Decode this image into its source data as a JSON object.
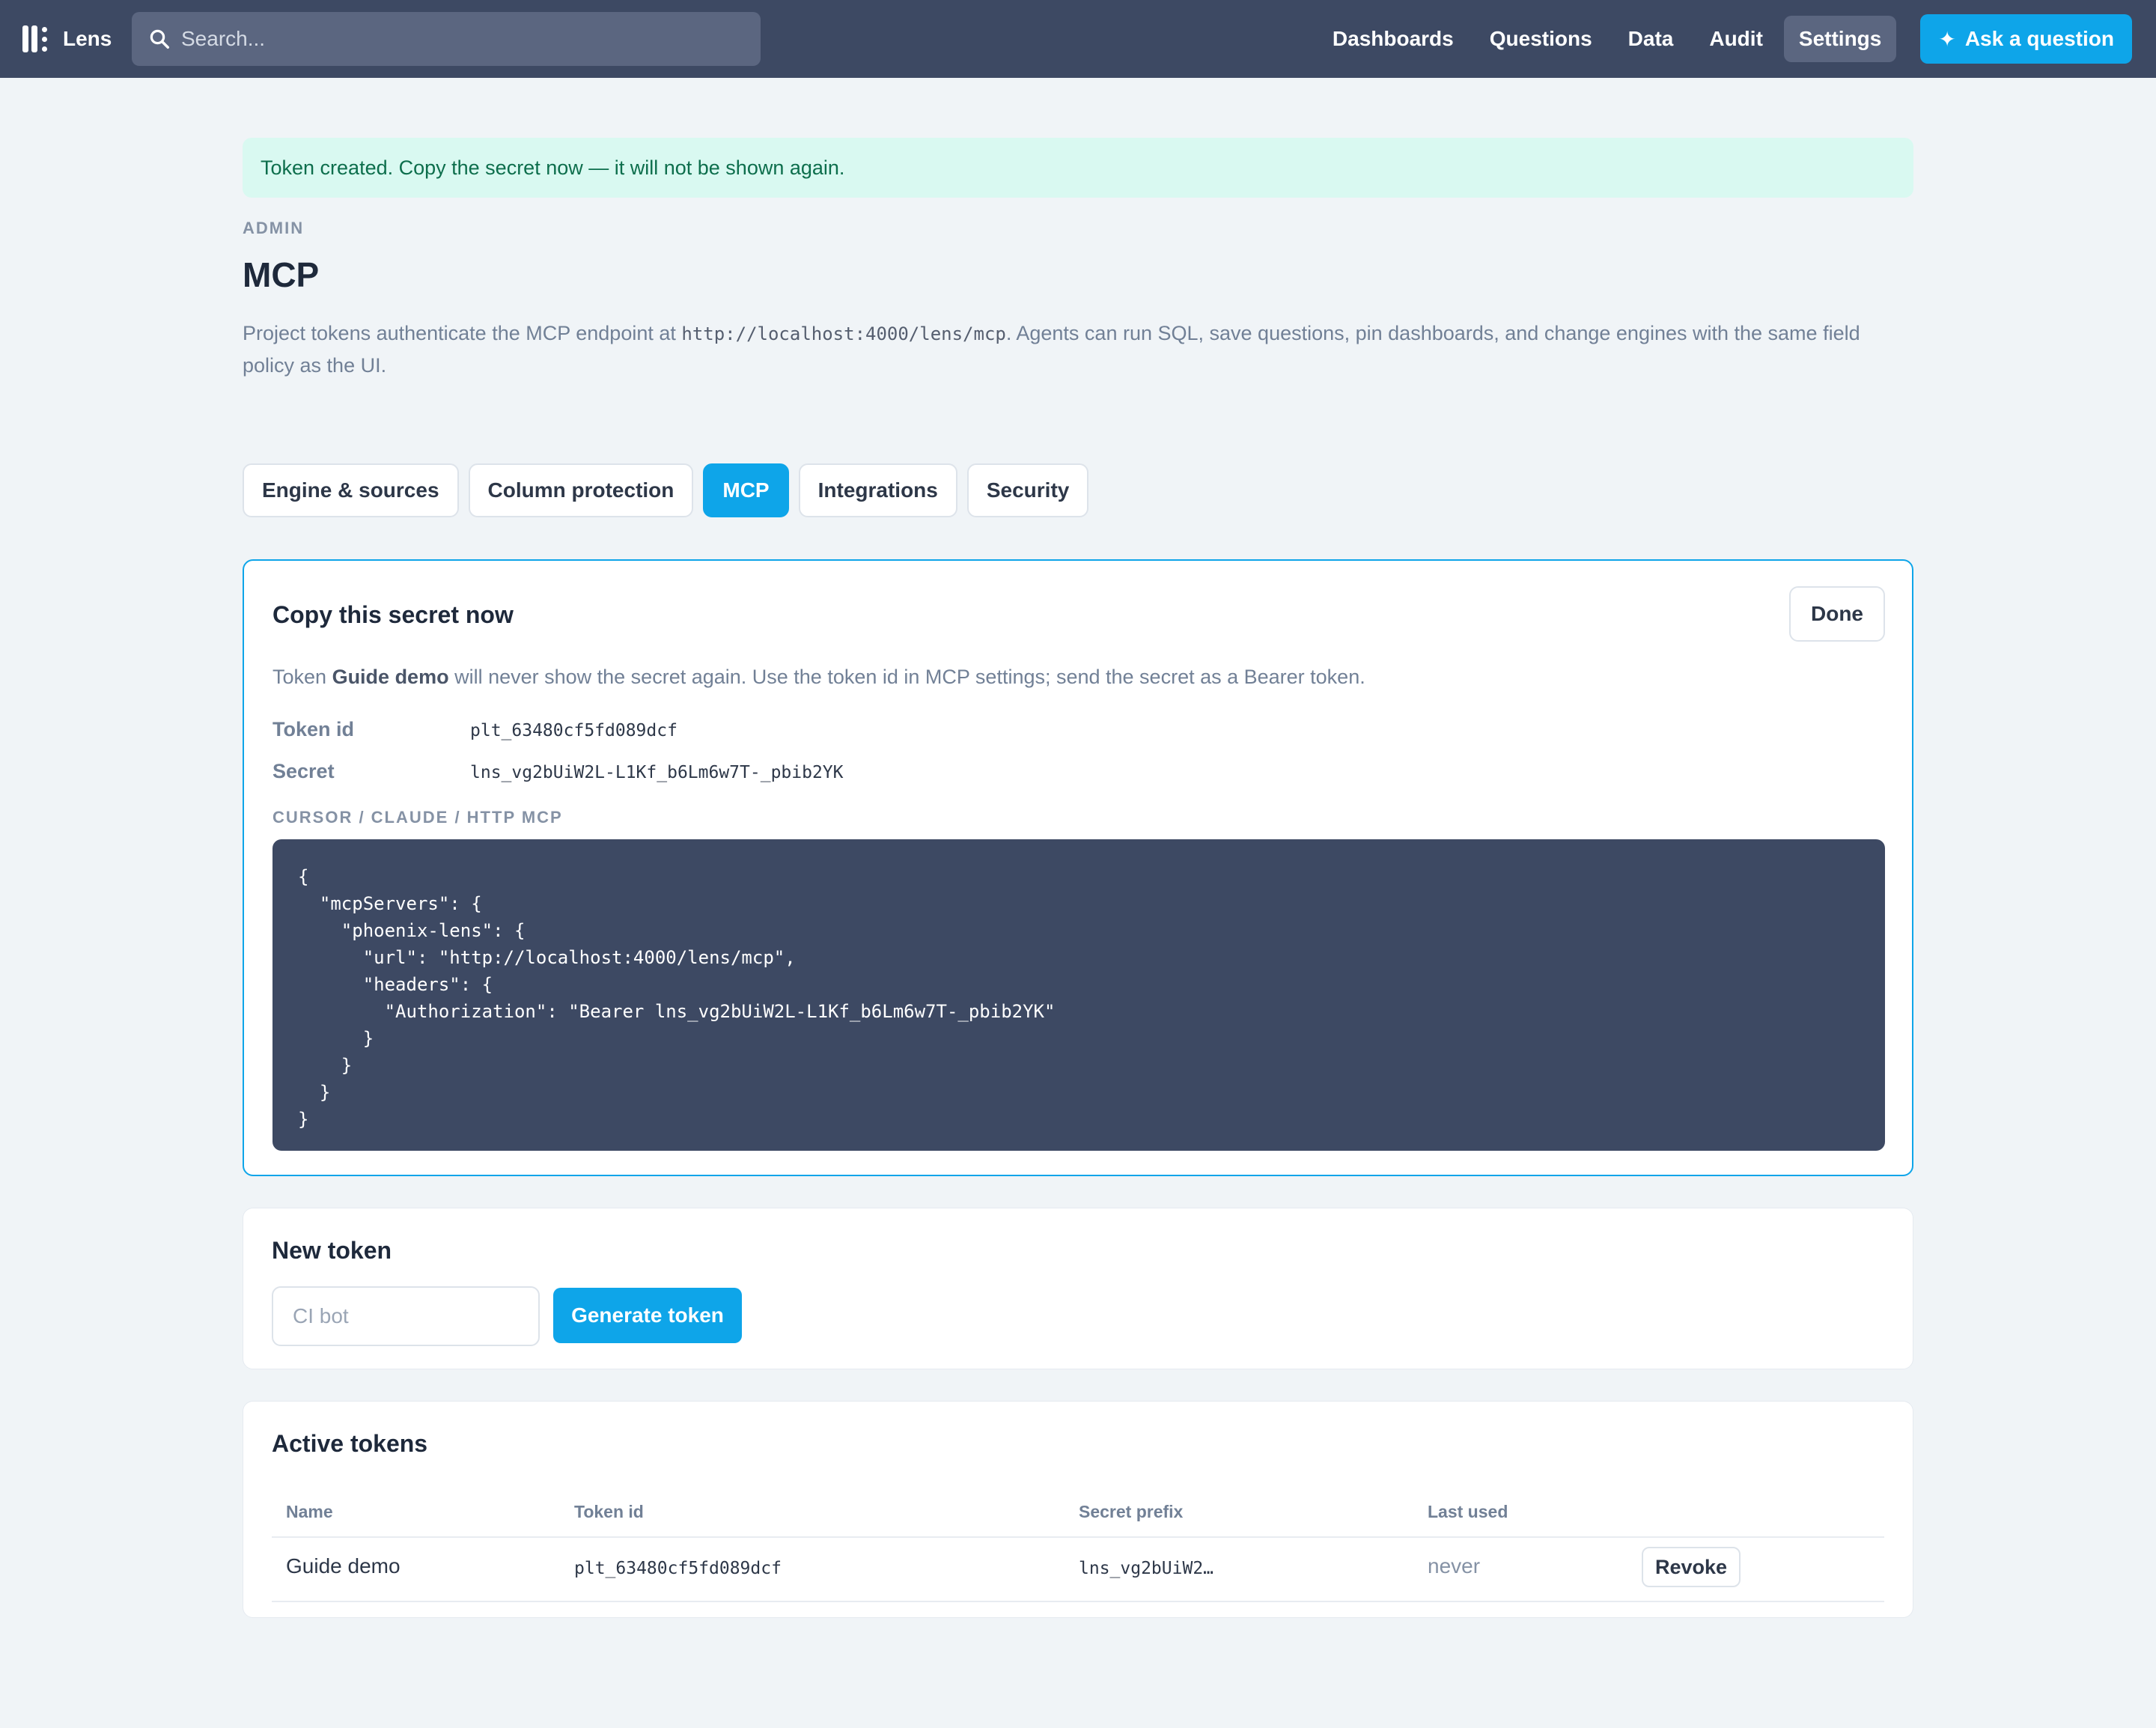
{
  "app": {
    "name": "Lens"
  },
  "search": {
    "placeholder": "Search..."
  },
  "nav": {
    "items": [
      "Dashboards",
      "Questions",
      "Data",
      "Audit",
      "Settings"
    ],
    "active": "Settings",
    "ask_label": "Ask a question"
  },
  "alert": {
    "message": "Token created. Copy the secret now — it will not be shown again."
  },
  "page": {
    "eyebrow": "ADMIN",
    "title": "MCP",
    "description_pre": "Project tokens authenticate the MCP endpoint at ",
    "endpoint": "http://localhost:4000/lens/mcp",
    "description_post": ". Agents can run SQL, save questions, pin dashboards, and change engines with the same field policy as the UI."
  },
  "tabs": [
    {
      "label": "Engine & sources",
      "active": false
    },
    {
      "label": "Column protection",
      "active": false
    },
    {
      "label": "MCP",
      "active": true
    },
    {
      "label": "Integrations",
      "active": false
    },
    {
      "label": "Security",
      "active": false
    }
  ],
  "secret_card": {
    "title": "Copy this secret now",
    "done_label": "Done",
    "note_pre": "Token ",
    "note_token_name": "Guide demo",
    "note_post": " will never show the secret again. Use the token id in MCP settings; send the secret as a Bearer token.",
    "token_id_label": "Token id",
    "token_id": "plt_63480cf5fd089dcf",
    "secret_label": "Secret",
    "secret": "lns_vg2bUiW2L-L1Kf_b6Lm6w7T-_pbib2YK",
    "code_label": "CURSOR / CLAUDE / HTTP MCP",
    "code": "{\n  \"mcpServers\": {\n    \"phoenix-lens\": {\n      \"url\": \"http://localhost:4000/lens/mcp\",\n      \"headers\": {\n        \"Authorization\": \"Bearer lns_vg2bUiW2L-L1Kf_b6Lm6w7T-_pbib2YK\"\n      }\n    }\n  }\n}"
  },
  "new_token": {
    "title": "New token",
    "input_placeholder": "CI bot",
    "generate_label": "Generate token"
  },
  "active_tokens": {
    "title": "Active tokens",
    "columns": [
      "Name",
      "Token id",
      "Secret prefix",
      "Last used"
    ],
    "rows": [
      {
        "name": "Guide demo",
        "token_id": "plt_63480cf5fd089dcf",
        "secret_prefix": "lns_vg2bUiW2…",
        "last_used": "never",
        "action": "Revoke"
      }
    ]
  },
  "colors": {
    "topbar": "#3d4963",
    "accent": "#0ea5e9",
    "alert_bg": "#d9f9f1",
    "alert_text": "#0d6e4c",
    "page_bg": "#f0f4f7"
  }
}
